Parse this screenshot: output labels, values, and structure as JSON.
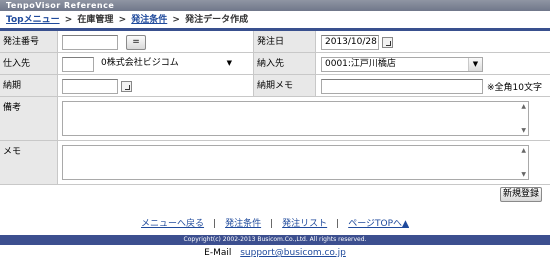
{
  "window": {
    "title": "TenpoVisor Reference"
  },
  "breadcrumb": {
    "top": "Topメニュー",
    "sep1": ">",
    "inventory": "在庫管理",
    "sep2": ">",
    "order_terms": "発注条件",
    "sep3": ">",
    "current": "発注データ作成"
  },
  "form": {
    "order_number": {
      "label": "発注番号",
      "value": "",
      "button": "="
    },
    "order_date": {
      "label": "発注日",
      "value": "2013/10/28"
    },
    "supplier": {
      "label": "仕入先",
      "code": "",
      "selected": "0株式会社ビジコム"
    },
    "delivery_dest": {
      "label": "納入先",
      "selected": "0001:江戸川橋店"
    },
    "delivery_date": {
      "label": "納期",
      "value": ""
    },
    "delivery_memo": {
      "label": "納期メモ",
      "value": "",
      "note": "※全角10文字"
    },
    "remarks": {
      "label": "備考",
      "value": ""
    },
    "memo": {
      "label": "メモ",
      "value": ""
    },
    "register_button": "新規登録"
  },
  "footer": {
    "links": [
      "メニューへ戻る",
      "発注条件",
      "発注リスト",
      "ページTOPへ▲"
    ],
    "copyright": "Copyright(c) 2002-2013 Busicom.Co.,Ltd. All rights reserved.",
    "email_label": "E-Mail",
    "email": "support@busicom.co.jp"
  }
}
